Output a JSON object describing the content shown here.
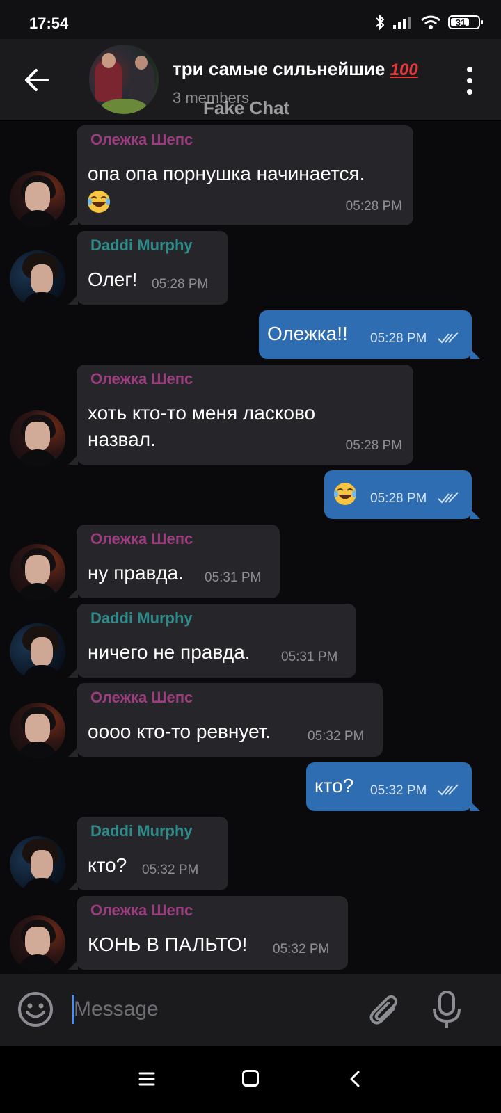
{
  "status_bar": {
    "time": "17:54",
    "battery": "31"
  },
  "header": {
    "title": "три самые сильнейшие",
    "title_emoji": "100",
    "subtitle": "3 members",
    "watermark": "Fake Chat"
  },
  "messages": [
    {
      "sender": "Олежка Шепс",
      "text_line1": "опа опа порнушка начинается.",
      "time": "05:28 PM"
    },
    {
      "sender": "Daddi Murphy",
      "text": "Олег!",
      "time": "05:28 PM"
    },
    {
      "text": "Олежка!!",
      "time": "05:28 PM"
    },
    {
      "sender": "Олежка Шепс",
      "text_line1": "хоть кто-то меня ласково",
      "text_line2": "назвал.",
      "time": "05:28 PM"
    },
    {
      "time": "05:28 PM"
    },
    {
      "sender": "Олежка Шепс",
      "text": "ну правда.",
      "time": "05:31 PM"
    },
    {
      "sender": "Daddi Murphy",
      "text": "ничего не правда.",
      "time": "05:31 PM"
    },
    {
      "sender": "Олежка Шепс",
      "text": "оооо кто-то ревнует.",
      "time": "05:32 PM"
    },
    {
      "text": "кто?",
      "time": "05:32 PM"
    },
    {
      "sender": "Daddi Murphy",
      "text": "кто?",
      "time": "05:32 PM"
    },
    {
      "sender": "Олежка Шепс",
      "text": "КОНЬ В ПАЛЬТО!",
      "time": "05:32 PM"
    }
  ],
  "input": {
    "placeholder": "Message"
  },
  "colors": {
    "outgoing_bubble": "#2f6db3",
    "incoming_bubble": "#26262a",
    "oleg_name": "#9b3d7f",
    "daddi_name": "#2e8c8a"
  },
  "icons": [
    "back-arrow-icon",
    "more-vert-icon",
    "smile-icon",
    "attach-icon",
    "mic-icon",
    "nav-menu-icon",
    "nav-home-icon",
    "nav-back-icon",
    "double-check-icon",
    "laughing-emoji-icon"
  ]
}
